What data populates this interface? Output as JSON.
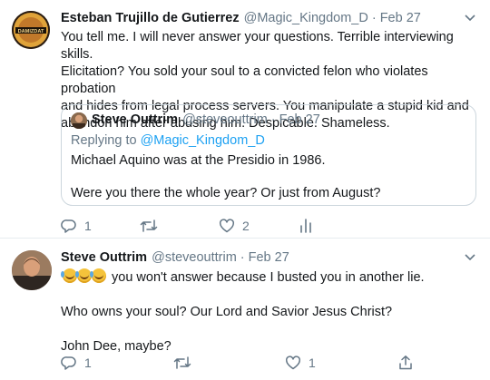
{
  "tweet1": {
    "avatar_text": "DAMIZDAT",
    "name": "Esteban Trujillo de Gutierrez",
    "handle": "@Magic_Kingdom_D",
    "date": "Feb 27",
    "lines": [
      "You tell me. I will never answer your questions. Terrible interviewing skills.",
      "Elicitation? You sold your soul to a convicted felon who violates probation",
      "and hides from legal process servers. You manipulate a stupid kid and",
      "abandon him after abusing him. Despicable. Shameless."
    ],
    "quote": {
      "name": "Steve Outtrim",
      "handle": "@steveouttrim",
      "date": "Feb 27",
      "replying_prefix": "Replying to ",
      "replying_to": "@Magic_Kingdom_D",
      "line1": "Michael Aquino was at the Presidio in 1986.",
      "line2": "Were you there the whole year? Or just from August?"
    },
    "reply_count": "1",
    "like_count": "2"
  },
  "tweet2": {
    "name": "Steve Outtrim",
    "handle": "@steveouttrim",
    "date": "Feb 27",
    "emoji": "🤣🤣🤣",
    "line1": " you won't answer because I busted you in another lie.",
    "line2": "Who owns your soul? Our Lord and Savior Jesus Christ?",
    "line3": "John Dee, maybe?",
    "reply_count": "1",
    "like_count": "1"
  },
  "colors": {
    "text": "#14171a",
    "muted": "#657786",
    "link": "#1da1f2",
    "border": "#e6ecf0"
  },
  "icons": [
    "reply-icon",
    "retweet-icon",
    "like-icon",
    "analytics-icon",
    "share-icon",
    "chevron-down-icon"
  ]
}
